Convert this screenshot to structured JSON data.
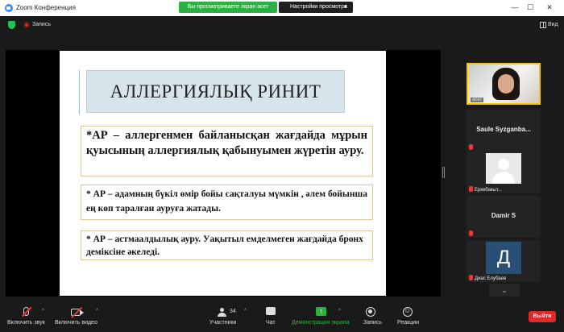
{
  "window": {
    "title": "Zoom Конференция",
    "share_banner": "Вы просматриваете экран асет",
    "view_options": "Настройки просмотра",
    "minimize": "—",
    "maximize": "☐",
    "close": "✕"
  },
  "topbar": {
    "recording_label": "Запись",
    "view_label": "Вид"
  },
  "slide": {
    "title": "АЛЛЕРГИЯЛЫҚ РИНИТ",
    "box1": "*АР – аллергенмен байланысқан жағдайда мұрын қуысының аллергиялық қабынуымен жүретін ауру.",
    "box2": "* АР – адамның бүкіл өмір бойы сақталуы мүмкін , әлем бойынша ең көп таралған ауруға жатады.",
    "box3": "* АР – астмаалдылық ауру. Уақытыл емделмеген жағдайда бронх деміксіне әкеледі."
  },
  "participants": [
    {
      "name": "асет",
      "video": true,
      "active": true
    },
    {
      "name": "Saule Syzganba...",
      "video": false,
      "muted": true
    },
    {
      "name": "Еркебакыт...",
      "video": false,
      "muted": true
    },
    {
      "name": "Damir S",
      "video": false,
      "muted": true
    },
    {
      "name": "Диас Елубаев",
      "video": false,
      "muted": true,
      "initial": "Д"
    }
  ],
  "sidebar": {
    "scroll_down": "⌄"
  },
  "toolbar": {
    "unmute_label": "Включить звук",
    "start_video_label": "Включить видео",
    "participants_label": "Участники",
    "participants_count": "34",
    "chat_label": "Чат",
    "share_label": "Демонстрация экрана",
    "record_label": "Запись",
    "reactions_label": "Реакции",
    "leave_label": "Выйти",
    "caret": "^",
    "share_arrow": "↑",
    "reactions_glyph": "☺"
  },
  "colors": {
    "share_green": "#2db043",
    "leave_red": "#e02828",
    "active_speaker": "#f6c600",
    "slide_title_bg": "#d6e5ec"
  }
}
